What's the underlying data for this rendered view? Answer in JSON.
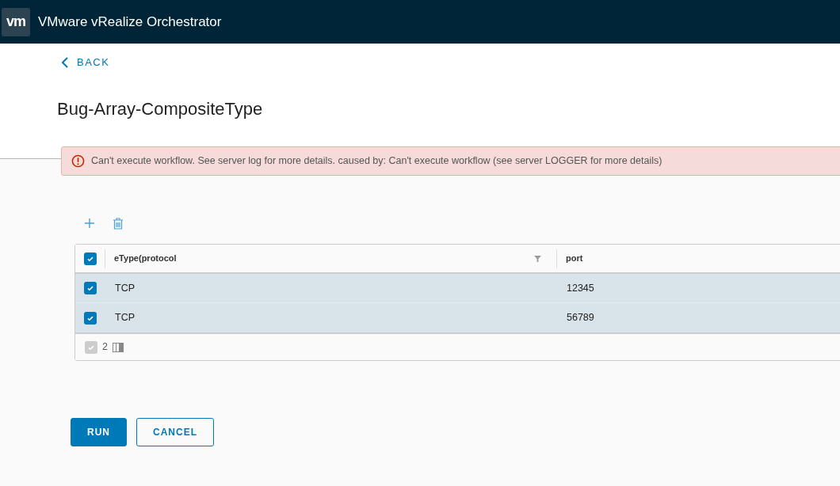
{
  "header": {
    "logo": "vm",
    "title": "VMware vRealize Orchestrator"
  },
  "back_link": "BACK",
  "page_title": "Bug-Array-CompositeType",
  "alert": {
    "message": "Can't execute workflow. See server log for more details. caused by: Can't execute workflow (see server LOGGER for more details)"
  },
  "table": {
    "select_all": true,
    "columns": [
      {
        "label": "eType(protocol",
        "filter": true
      },
      {
        "label": "port",
        "filter": false
      }
    ],
    "rows": [
      {
        "cells": [
          "TCP",
          "12345"
        ],
        "selected": true
      },
      {
        "cells": [
          "TCP",
          "56789"
        ],
        "selected": true
      }
    ],
    "footer": {
      "checked": true,
      "disabled": true,
      "count": "2"
    }
  },
  "buttons": [
    {
      "label": "RUN",
      "kind": "primary"
    },
    {
      "label": "CANCEL",
      "kind": "outline"
    }
  ]
}
